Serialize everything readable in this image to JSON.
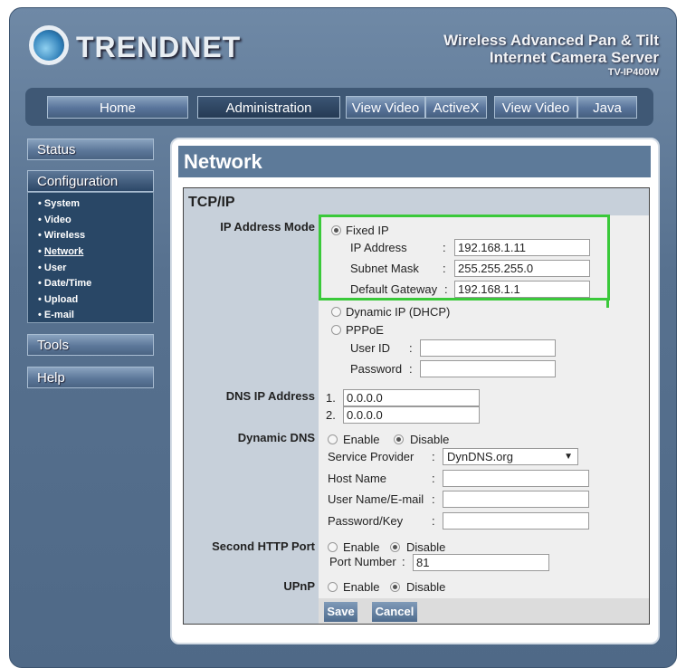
{
  "header": {
    "brand": "TRENDNET",
    "product_line1": "Wireless Advanced Pan & Tilt",
    "product_line2": "Internet Camera Server",
    "model": "TV-IP400W"
  },
  "nav": {
    "home": "Home",
    "administration": "Administration",
    "view_video_activex_1": "View Video",
    "view_video_activex_2": "ActiveX",
    "view_video_java_1": "View Video",
    "view_video_java_2": "Java"
  },
  "sidebar": {
    "status": "Status",
    "configuration": "Configuration",
    "items": [
      "System",
      "Video",
      "Wireless",
      "Network",
      "User",
      "Date/Time",
      "Upload",
      "E-mail"
    ],
    "active": "Network",
    "tools": "Tools",
    "help": "Help"
  },
  "page": {
    "title": "Network",
    "section": "TCP/IP"
  },
  "ip_mode": {
    "label": "IP Address Mode",
    "selected": "Fixed IP",
    "fixed": "Fixed IP",
    "ip_label": "IP Address",
    "ip": "192.168.1.11",
    "mask_label": "Subnet Mask",
    "mask": "255.255.255.0",
    "gw_label": "Default Gateway",
    "gw": "192.168.1.1",
    "dhcp": "Dynamic IP (DHCP)",
    "pppoe": "PPPoE",
    "user_label": "User ID",
    "user": "",
    "pass_label": "Password",
    "pass": ""
  },
  "dns": {
    "label": "DNS IP Address",
    "n1": "1.",
    "v1": "0.0.0.0",
    "n2": "2.",
    "v2": "0.0.0.0"
  },
  "ddns": {
    "label": "Dynamic DNS",
    "enable": "Enable",
    "disable": "Disable",
    "selected": "Disable",
    "provider_label": "Service Provider",
    "provider": "DynDNS.org",
    "host_label": "Host Name",
    "host": "",
    "user_label": "User Name/E-mail",
    "user": "",
    "pass_label": "Password/Key",
    "pass": ""
  },
  "http2": {
    "label": "Second HTTP Port",
    "enable": "Enable",
    "disable": "Disable",
    "selected": "Disable",
    "port_label": "Port Number",
    "port": "81"
  },
  "upnp": {
    "label": "UPnP",
    "enable": "Enable",
    "disable": "Disable",
    "selected": "Disable"
  },
  "buttons": {
    "save": "Save",
    "cancel": "Cancel"
  },
  "colon": ":",
  "colors": {
    "highlight": "#3ac93a",
    "header": "#5d7a99"
  }
}
